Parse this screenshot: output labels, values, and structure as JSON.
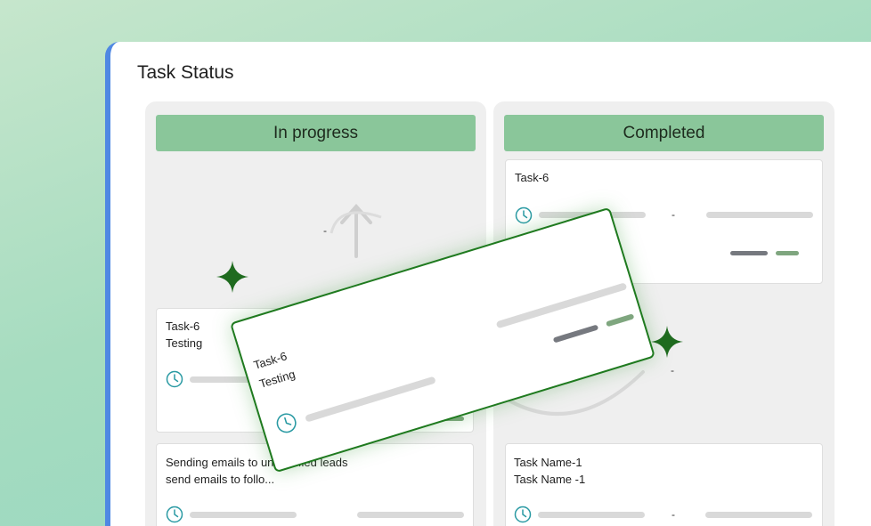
{
  "panel": {
    "title": "Task Status"
  },
  "columns": [
    {
      "header": "In progress",
      "placeholder_dash": "-",
      "cards": [
        {
          "title": "Task-6",
          "subtitle": "Testing"
        },
        {
          "title": "Sending emails to unqualified leads",
          "subtitle": "send emails to follo..."
        }
      ]
    },
    {
      "header": "Completed",
      "placeholder_dash": "-",
      "cards": [
        {
          "title": "Task-6",
          "dash": "-"
        },
        {
          "title": "Task Name-1",
          "subtitle": "Task Name -1",
          "dash": "-"
        }
      ]
    }
  ],
  "dragging_card": {
    "title": "Task-6",
    "subtitle": "Testing"
  },
  "colors": {
    "accent_green": "#8ac69a",
    "drag_border": "#1f7a1f",
    "clock_teal": "#2a9aa3",
    "pill_gray": "#76797f",
    "pill_green": "#7fa67f"
  },
  "icons": [
    "clock-icon",
    "arrow-up-icon",
    "sparkle-icon"
  ]
}
